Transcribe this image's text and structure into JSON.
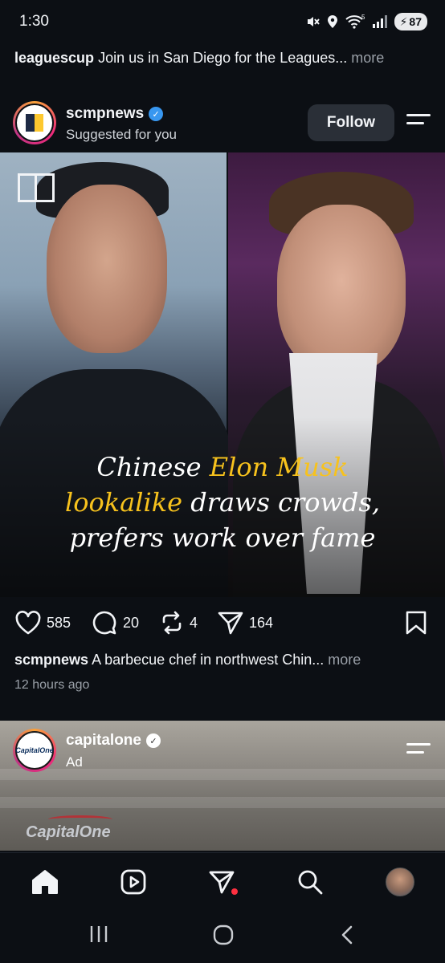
{
  "status_bar": {
    "time": "1:30",
    "battery": "87",
    "wifi_badge": "5"
  },
  "top_caption": {
    "username": "leaguescup",
    "text": "Join us in San Diego for the Leagues...",
    "more": "more"
  },
  "post": {
    "username": "scmpnews",
    "subtitle": "Suggested for you",
    "follow_label": "Follow",
    "headline": {
      "line1_a": "Chinese ",
      "line1_b": "Elon Musk",
      "line2_a": "lookalike",
      "line2_b": " draws crowds,",
      "line3": "prefers work over fame"
    },
    "likes": "585",
    "comments": "20",
    "reposts": "4",
    "shares": "164",
    "caption_user": "scmpnews",
    "caption_text": "A barbecue chef in northwest Chin...",
    "caption_more": "more",
    "timestamp": "12 hours ago"
  },
  "ad": {
    "username": "capitalone",
    "label": "Ad",
    "avatar_text": "CapitalOne",
    "logo_text": "CapitalOne"
  },
  "colors": {
    "background": "#0c0f14",
    "headline_highlight": "#f7c21d",
    "verified": "#3897f0",
    "notification": "#ff3040"
  }
}
